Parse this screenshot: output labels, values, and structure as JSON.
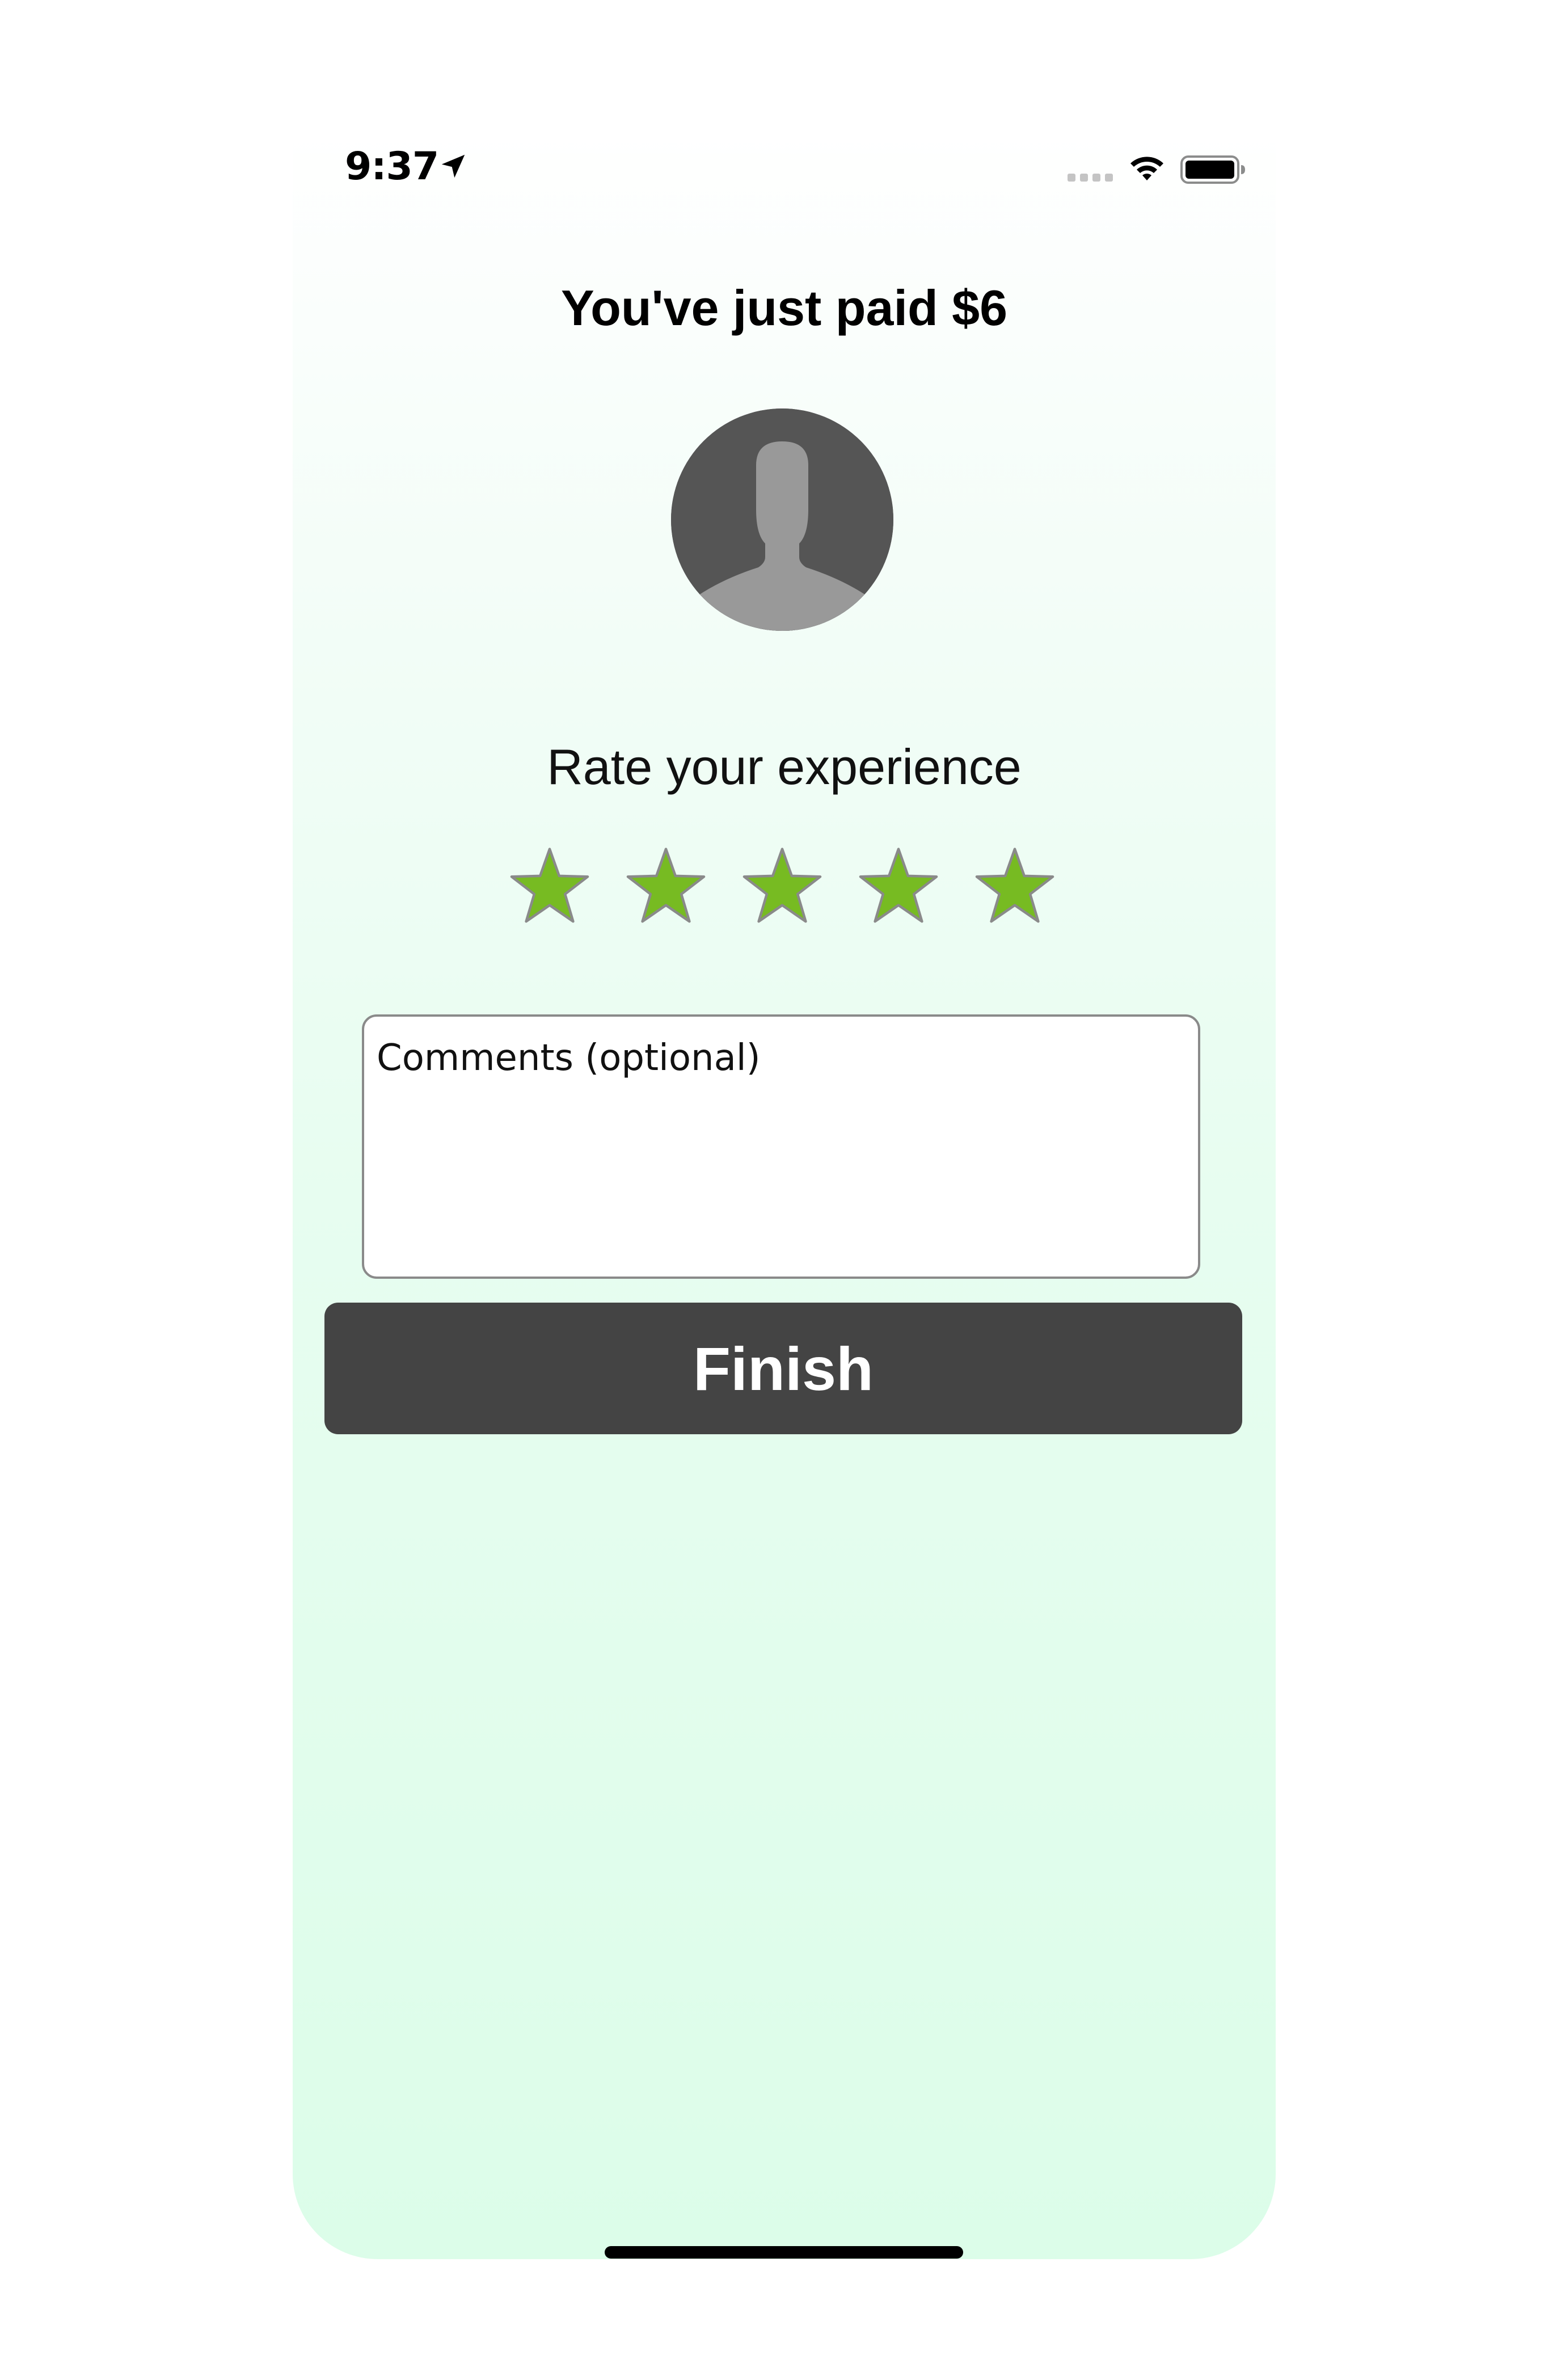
{
  "status_bar": {
    "time": "9:37",
    "icons": [
      "location-arrow-icon",
      "cellular-signal-icon",
      "wifi-icon",
      "battery-icon"
    ]
  },
  "payment": {
    "title": "You've just paid $6"
  },
  "avatar": {
    "icon": "person-silhouette-icon"
  },
  "rating": {
    "label": "Rate your experience",
    "value": 5,
    "max": 5,
    "star_color": "#77bb22",
    "star_outline": "#8a8a8a"
  },
  "comments": {
    "placeholder": "Comments (optional)",
    "value": ""
  },
  "actions": {
    "finish_label": "Finish",
    "finish_color": "#444444"
  },
  "colors": {
    "background_top": "#ffffff",
    "background_bottom": "#dcfde9"
  }
}
